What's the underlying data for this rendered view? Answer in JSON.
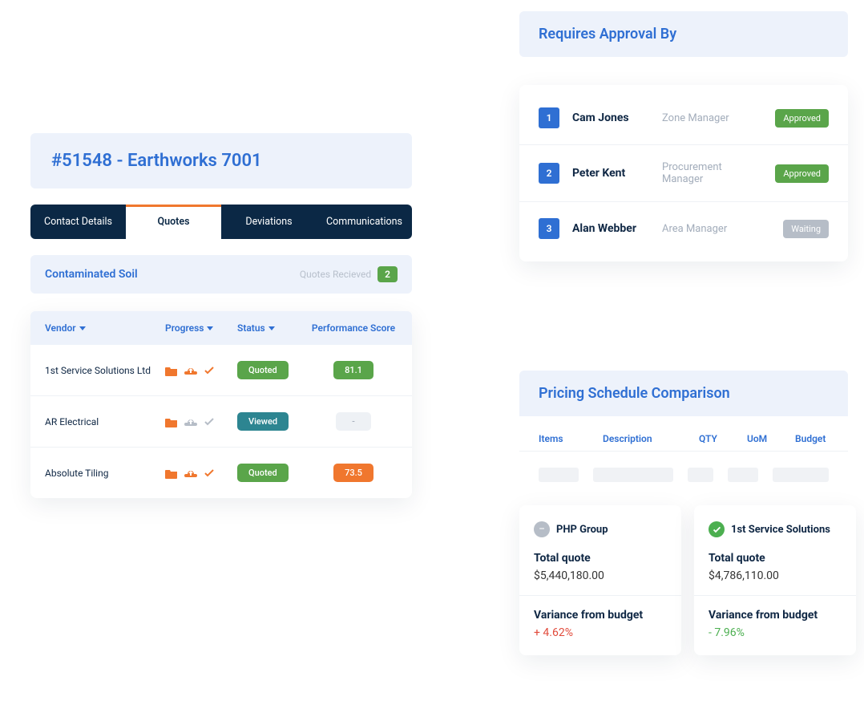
{
  "main": {
    "title": "#51548 - Earthworks 7001",
    "tabs": [
      "Contact Details",
      "Quotes",
      "Deviations",
      "Communications"
    ],
    "active_tab": 1,
    "section": {
      "title": "Contaminated Soil",
      "quotes_received_label": "Quotes Recieved",
      "quotes_received_count": "2"
    },
    "columns": {
      "vendor": "Vendor",
      "progress": "Progress",
      "status": "Status",
      "score": "Performance Score"
    },
    "rows": [
      {
        "vendor": "1st  Service Solutions Ltd",
        "status": "Quoted",
        "status_class": "pill-green",
        "score": "81.1",
        "score_class": "pill-green",
        "progress_icons": "active"
      },
      {
        "vendor": "AR Electrical",
        "status": "Viewed",
        "status_class": "pill-teal",
        "score": "-",
        "score_class": "pill-gray",
        "progress_icons": "inactive"
      },
      {
        "vendor": "Absolute Tiling",
        "status": "Quoted",
        "status_class": "pill-green",
        "score": "73.5",
        "score_class": "pill-orange",
        "progress_icons": "active"
      }
    ]
  },
  "approvals": {
    "title": "Requires Approval By",
    "rows": [
      {
        "num": "1",
        "name": "Cam Jones",
        "role": "Zone Manager",
        "status": "Approved",
        "status_class": "st-approved"
      },
      {
        "num": "2",
        "name": "Peter Kent",
        "role": "Procurement Manager",
        "status": "Approved",
        "status_class": "st-approved"
      },
      {
        "num": "3",
        "name": "Alan Webber",
        "role": "Area Manager",
        "status": "Waiting",
        "status_class": "st-waiting"
      }
    ]
  },
  "pricing": {
    "title": "Pricing Schedule Comparison",
    "columns": {
      "items": "Items",
      "description": "Description",
      "qty": "QTY",
      "uom": "UoM",
      "budget": "Budget"
    },
    "cards": [
      {
        "name": "PHP Group",
        "icon": "minus",
        "total_label": "Total quote",
        "total_value": "$5,440,180.00",
        "variance_label": "Variance from budget",
        "variance_value": "+ 4.62%",
        "variance_class": "pos"
      },
      {
        "name": "1st  Service Solutions",
        "icon": "check",
        "total_label": "Total quote",
        "total_value": "$4,786,110.00",
        "variance_label": "Variance from budget",
        "variance_value": "- 7.96%",
        "variance_class": "neg"
      }
    ]
  }
}
